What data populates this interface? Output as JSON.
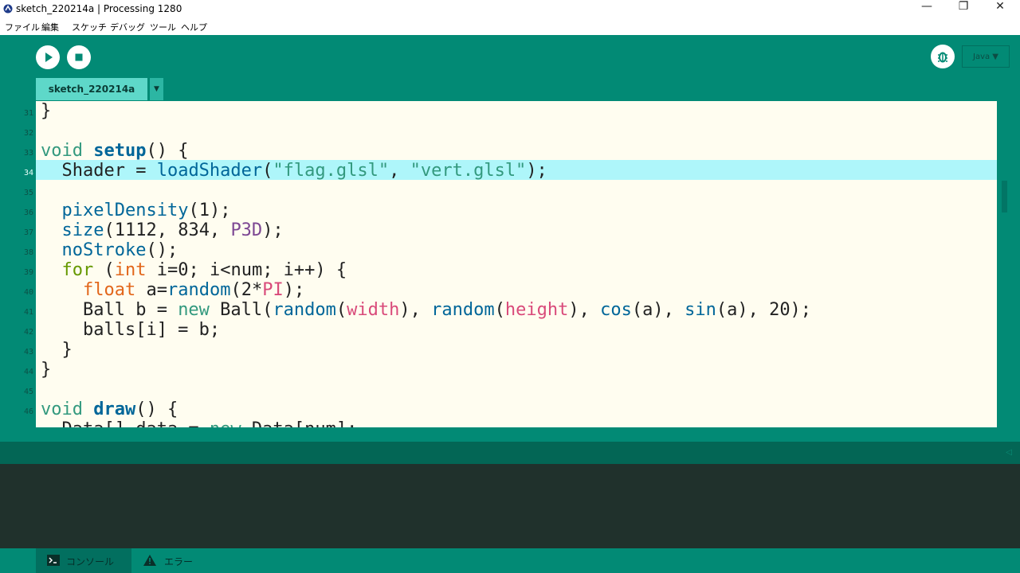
{
  "window": {
    "title": "sketch_220214a | Processing 1280",
    "controls": {
      "minimize": "—",
      "restore": "❐",
      "close": "✕"
    }
  },
  "menu": [
    "ファイル",
    "編集",
    "スケッチ",
    "デバッグ",
    "ツール",
    "ヘルプ"
  ],
  "toolbar": {
    "run_icon": "play-icon",
    "stop_icon": "stop-icon",
    "debug_icon": "debugger-icon",
    "mode_label": "Java ▼"
  },
  "tabs": {
    "active": "sketch_220214a",
    "menu_glyph": "▼"
  },
  "editor": {
    "current_line": "34",
    "line_numbers": [
      "31",
      "32",
      "33",
      "34",
      "35",
      "36",
      "37",
      "38",
      "39",
      "40",
      "41",
      "42",
      "43",
      "44",
      "45",
      "46"
    ],
    "lines": [
      [
        {
          "t": "}",
          "c": ""
        }
      ],
      [],
      [
        {
          "t": "void",
          "c": "kw1"
        },
        {
          "t": " ",
          "c": ""
        },
        {
          "t": "setup",
          "c": "kw2b"
        },
        {
          "t": "() {",
          "c": ""
        }
      ],
      [
        {
          "t": "  Shader = ",
          "c": ""
        },
        {
          "t": "loadShader",
          "c": "fn"
        },
        {
          "t": "(",
          "c": ""
        },
        {
          "t": "\"flag.glsl\"",
          "c": "kw1"
        },
        {
          "t": ", ",
          "c": ""
        },
        {
          "t": "\"vert.glsl\"",
          "c": "kw1"
        },
        {
          "t": ");",
          "c": ""
        }
      ],
      [],
      [
        {
          "t": "  ",
          "c": ""
        },
        {
          "t": "pixelDensity",
          "c": "fn"
        },
        {
          "t": "(1);",
          "c": ""
        }
      ],
      [
        {
          "t": "  ",
          "c": ""
        },
        {
          "t": "size",
          "c": "fn"
        },
        {
          "t": "(1112, 834, ",
          "c": ""
        },
        {
          "t": "P3D",
          "c": "c6"
        },
        {
          "t": ");",
          "c": ""
        }
      ],
      [
        {
          "t": "  ",
          "c": ""
        },
        {
          "t": "noStroke",
          "c": "fn"
        },
        {
          "t": "();",
          "c": ""
        }
      ],
      [
        {
          "t": "  ",
          "c": ""
        },
        {
          "t": "for",
          "c": "c5"
        },
        {
          "t": " (",
          "c": ""
        },
        {
          "t": "int",
          "c": "c4"
        },
        {
          "t": " i=0; i<num; i++) {",
          "c": ""
        }
      ],
      [
        {
          "t": "    ",
          "c": ""
        },
        {
          "t": "float",
          "c": "c4"
        },
        {
          "t": " a=",
          "c": ""
        },
        {
          "t": "random",
          "c": "fn"
        },
        {
          "t": "(2*",
          "c": ""
        },
        {
          "t": "PI",
          "c": "c3"
        },
        {
          "t": ");",
          "c": ""
        }
      ],
      [
        {
          "t": "    Ball b = ",
          "c": ""
        },
        {
          "t": "new",
          "c": "kw1"
        },
        {
          "t": " Ball(",
          "c": ""
        },
        {
          "t": "random",
          "c": "fn"
        },
        {
          "t": "(",
          "c": ""
        },
        {
          "t": "width",
          "c": "c3"
        },
        {
          "t": "), ",
          "c": ""
        },
        {
          "t": "random",
          "c": "fn"
        },
        {
          "t": "(",
          "c": ""
        },
        {
          "t": "height",
          "c": "c3"
        },
        {
          "t": "), ",
          "c": ""
        },
        {
          "t": "cos",
          "c": "fn"
        },
        {
          "t": "(a), ",
          "c": ""
        },
        {
          "t": "sin",
          "c": "fn"
        },
        {
          "t": "(a), 20);",
          "c": ""
        }
      ],
      [
        {
          "t": "    balls[i] = b;",
          "c": ""
        }
      ],
      [
        {
          "t": "  }",
          "c": ""
        }
      ],
      [
        {
          "t": "}",
          "c": ""
        }
      ],
      [],
      [
        {
          "t": "void",
          "c": "kw1"
        },
        {
          "t": " ",
          "c": ""
        },
        {
          "t": "draw",
          "c": "kw2b"
        },
        {
          "t": "() {",
          "c": ""
        }
      ],
      [
        {
          "t": "  Data[] data = ",
          "c": ""
        },
        {
          "t": "new",
          "c": "kw1"
        },
        {
          "t": " Data[num];",
          "c": ""
        }
      ]
    ]
  },
  "bottom_tabs": {
    "console": {
      "label": "コンソール",
      "icon": "terminal-icon"
    },
    "error": {
      "label": "エラー",
      "icon": "warning-icon"
    }
  },
  "colors": {
    "accent": "#028A75",
    "editor_bg": "#FFFDF0",
    "current_line": "#AEF6FA",
    "console_bg": "#20312C"
  }
}
